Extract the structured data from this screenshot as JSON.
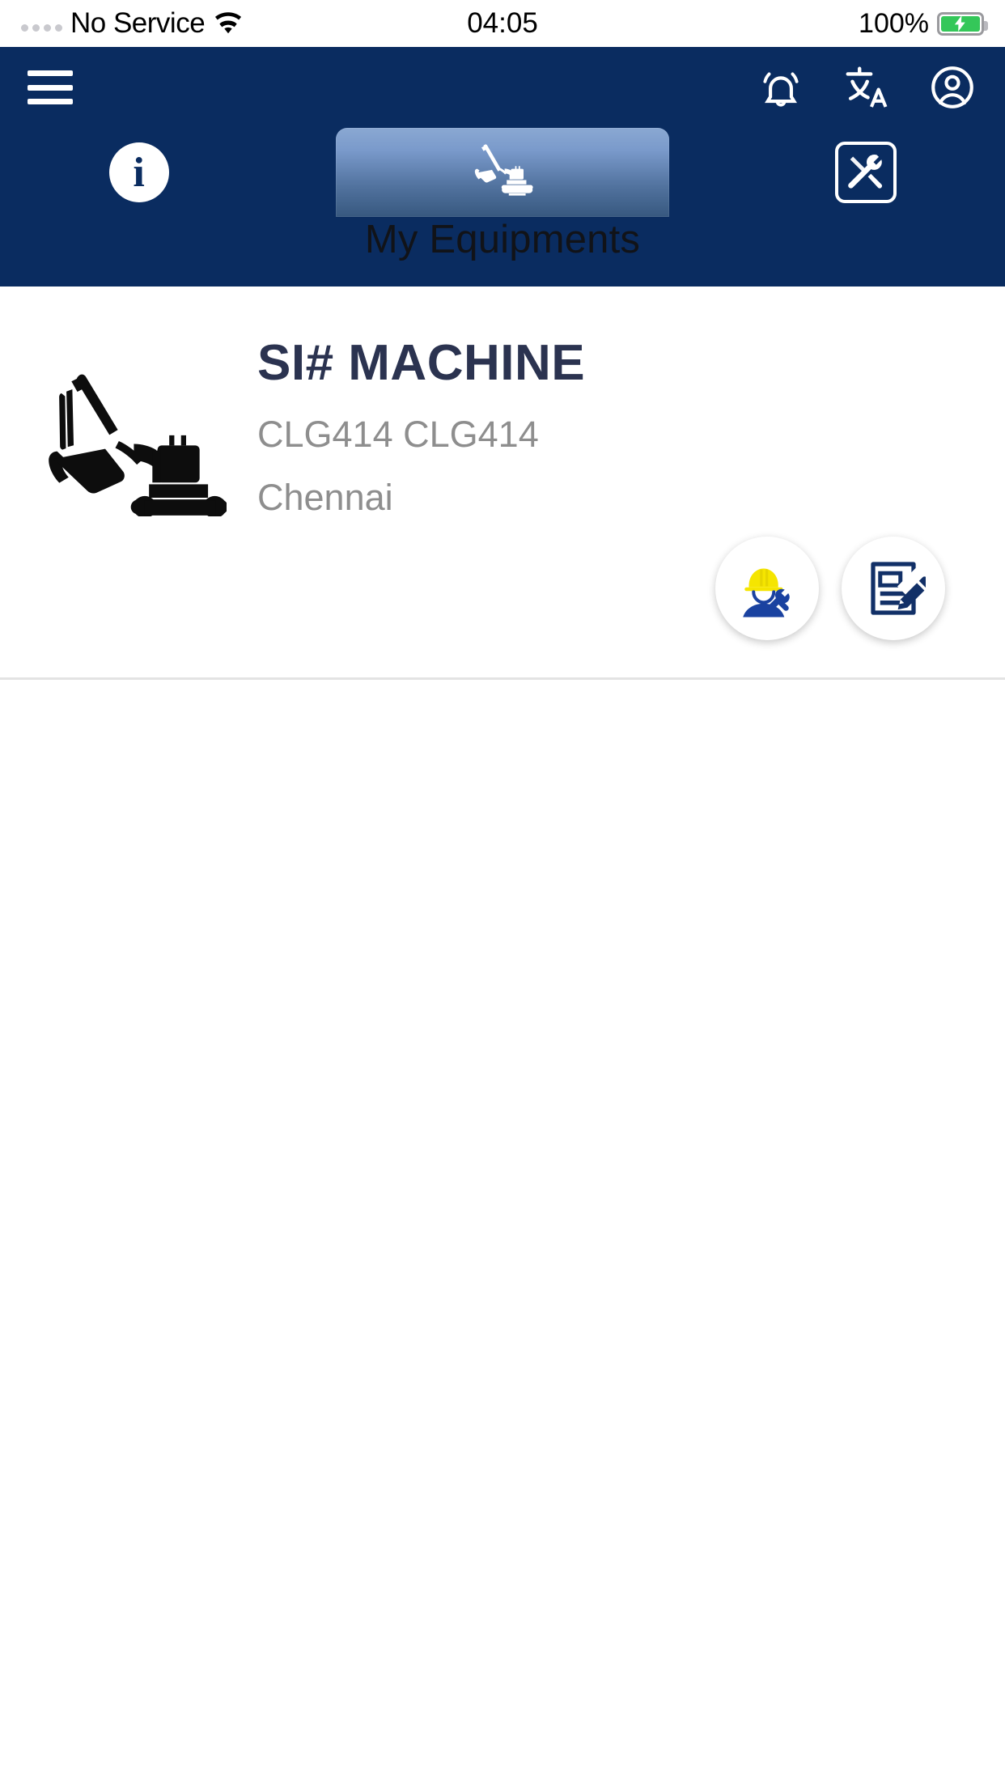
{
  "status_bar": {
    "carrier": "No Service",
    "wifi_icon": "wifi-icon",
    "signal_icon": "signal-dots-icon",
    "time": "04:05",
    "battery_percent": "100%",
    "battery_icon": "battery-charging-icon"
  },
  "header": {
    "background_color": "#0a2c60",
    "menu_icon": "hamburger-menu-icon",
    "actions": [
      {
        "name": "notifications-icon",
        "label": "Notifications"
      },
      {
        "name": "translate-icon",
        "label": "Translate"
      },
      {
        "name": "account-icon",
        "label": "Account"
      }
    ]
  },
  "tabs": {
    "selected_index": 1,
    "title": "My Equipments",
    "title_color": "#111318",
    "items": [
      {
        "name": "tab-info",
        "icon": "info-circle-icon",
        "glyph": "i",
        "selected": false
      },
      {
        "name": "tab-my-equipments",
        "icon": "excavator-icon",
        "selected": true
      },
      {
        "name": "tab-service",
        "icon": "tools-icon",
        "selected": false
      }
    ]
  },
  "equipment_list": [
    {
      "thumbnail_icon": "excavator-silhouette-icon",
      "name": "SI# MACHINE",
      "model": "CLG414 CLG414",
      "location": "Chennai",
      "name_color": "#2b3350",
      "meta_color": "#8e8e8e",
      "actions": [
        {
          "name": "service-request-button",
          "icon": "technician-helmet-tools-icon",
          "helmet_color": "#f5e500",
          "body_color": "#1a42a0"
        },
        {
          "name": "inspection-report-button",
          "icon": "document-edit-icon",
          "color": "#123067"
        }
      ]
    }
  ]
}
